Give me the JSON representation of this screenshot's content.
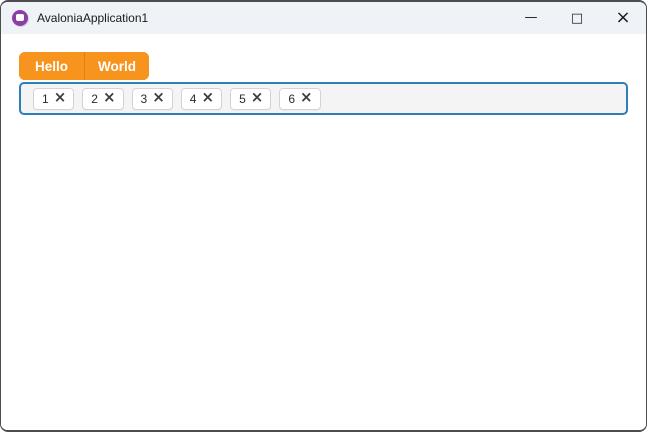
{
  "window": {
    "title": "AvaloniaApplication1",
    "icon": "avalonia-logo",
    "controls": {
      "minimize_glyph": "—",
      "maximize_glyph": "□",
      "close_glyph": "×"
    }
  },
  "button_group": {
    "buttons": [
      {
        "label": "Hello"
      },
      {
        "label": "World"
      }
    ]
  },
  "tag_box": {
    "tags": [
      {
        "label": "1"
      },
      {
        "label": "2"
      },
      {
        "label": "3"
      },
      {
        "label": "4"
      },
      {
        "label": "5"
      },
      {
        "label": "6"
      }
    ],
    "remove_glyph": "×"
  },
  "colors": {
    "accent_orange": "#F7941D",
    "tagbox_border": "#2E7FB8",
    "titlebar_bg": "#EFF3F8",
    "window_border": "#4C4C4C",
    "logo_purple": "#8B3FA6"
  }
}
